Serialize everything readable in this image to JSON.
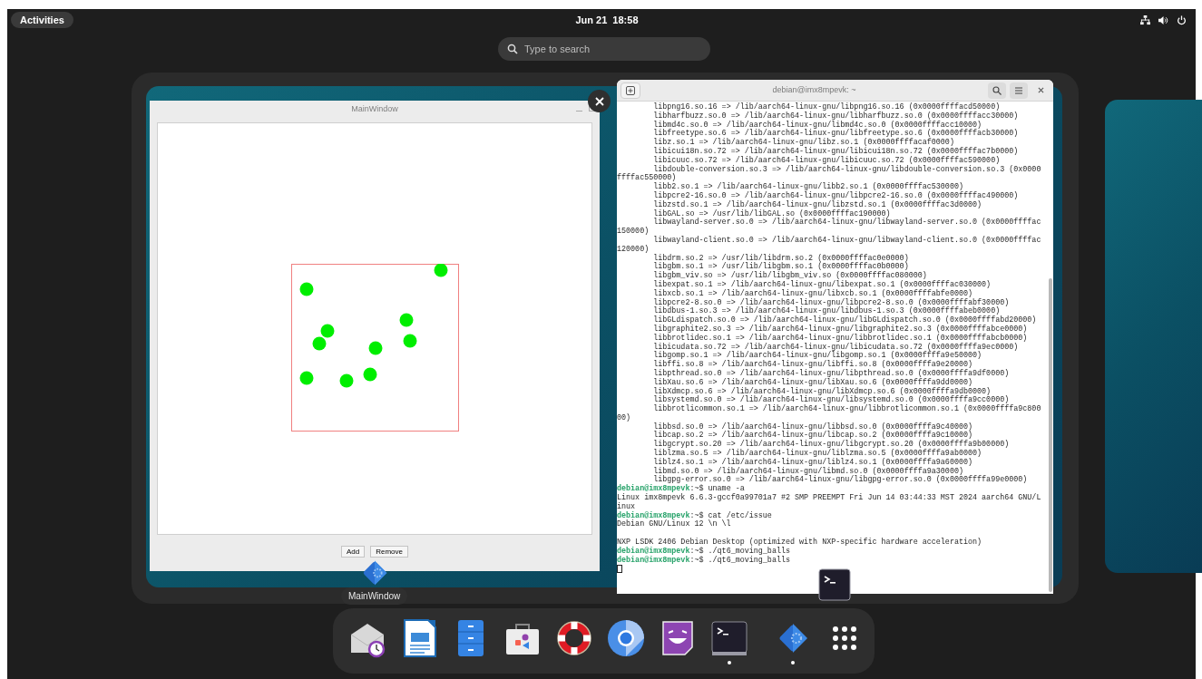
{
  "top_bar": {
    "activities": "Activities",
    "clock": "Jun 21  18:58"
  },
  "search": {
    "placeholder": "Type to search"
  },
  "qt_window": {
    "title": "MainWindow",
    "caption": "MainWindow",
    "buttons": [
      "Add",
      "Remove"
    ]
  },
  "terminal": {
    "title": "debian@imx8mpevk: ~",
    "lines": [
      {
        "kind": "output",
        "text": "\tlibpng16.so.16 => /lib/aarch64-linux-gnu/libpng16.so.16 (0x0000ffffacd50000)"
      },
      {
        "kind": "output",
        "text": "\tlibharfbuzz.so.0 => /lib/aarch64-linux-gnu/libharfbuzz.so.0 (0x0000ffffacc30000)"
      },
      {
        "kind": "output",
        "text": "\tlibmd4c.so.0 => /lib/aarch64-linux-gnu/libmd4c.so.0 (0x0000ffffacc10000)"
      },
      {
        "kind": "output",
        "text": "\tlibfreetype.so.6 => /lib/aarch64-linux-gnu/libfreetype.so.6 (0x0000ffffacb30000)"
      },
      {
        "kind": "output",
        "text": "\tlibz.so.1 => /lib/aarch64-linux-gnu/libz.so.1 (0x0000ffffacaf0000)"
      },
      {
        "kind": "output",
        "text": "\tlibicui18n.so.72 => /lib/aarch64-linux-gnu/libicui18n.so.72 (0x0000ffffac7b0000)"
      },
      {
        "kind": "output",
        "text": "\tlibicuuc.so.72 => /lib/aarch64-linux-gnu/libicuuc.so.72 (0x0000ffffac590000)"
      },
      {
        "kind": "output",
        "text": "\tlibdouble-conversion.so.3 => /lib/aarch64-linux-gnu/libdouble-conversion.so.3 (0x0000"
      },
      {
        "kind": "output",
        "text": "ffffac550000)"
      },
      {
        "kind": "output",
        "text": "\tlibb2.so.1 => /lib/aarch64-linux-gnu/libb2.so.1 (0x0000ffffac530000)"
      },
      {
        "kind": "output",
        "text": "\tlibpcre2-16.so.0 => /lib/aarch64-linux-gnu/libpcre2-16.so.0 (0x0000ffffac490000)"
      },
      {
        "kind": "output",
        "text": "\tlibzstd.so.1 => /lib/aarch64-linux-gnu/libzstd.so.1 (0x0000ffffac3d0000)"
      },
      {
        "kind": "output",
        "text": "\tlibGAL.so => /usr/lib/libGAL.so (0x0000ffffac190000)"
      },
      {
        "kind": "output",
        "text": "\tlibwayland-server.so.0 => /lib/aarch64-linux-gnu/libwayland-server.so.0 (0x0000ffffac"
      },
      {
        "kind": "output",
        "text": "150000)"
      },
      {
        "kind": "output",
        "text": "\tlibwayland-client.so.0 => /lib/aarch64-linux-gnu/libwayland-client.so.0 (0x0000ffffac"
      },
      {
        "kind": "output",
        "text": "120000)"
      },
      {
        "kind": "output",
        "text": "\tlibdrm.so.2 => /usr/lib/libdrm.so.2 (0x0000ffffac0e0000)"
      },
      {
        "kind": "output",
        "text": "\tlibgbm.so.1 => /usr/lib/libgbm.so.1 (0x0000ffffac0b0000)"
      },
      {
        "kind": "output",
        "text": "\tlibgbm_viv.so => /usr/lib/libgbm_viv.so (0x0000ffffac080000)"
      },
      {
        "kind": "output",
        "text": "\tlibexpat.so.1 => /lib/aarch64-linux-gnu/libexpat.so.1 (0x0000ffffac030000)"
      },
      {
        "kind": "output",
        "text": "\tlibxcb.so.1 => /lib/aarch64-linux-gnu/libxcb.so.1 (0x0000ffffabfe0000)"
      },
      {
        "kind": "output",
        "text": "\tlibpcre2-8.so.0 => /lib/aarch64-linux-gnu/libpcre2-8.so.0 (0x0000ffffabf30000)"
      },
      {
        "kind": "output",
        "text": "\tlibdbus-1.so.3 => /lib/aarch64-linux-gnu/libdbus-1.so.3 (0x0000ffffabeb0000)"
      },
      {
        "kind": "output",
        "text": "\tlibGLdispatch.so.0 => /lib/aarch64-linux-gnu/libGLdispatch.so.0 (0x0000ffffabd20000)"
      },
      {
        "kind": "output",
        "text": "\tlibgraphite2.so.3 => /lib/aarch64-linux-gnu/libgraphite2.so.3 (0x0000ffffabce0000)"
      },
      {
        "kind": "output",
        "text": "\tlibbrotlidec.so.1 => /lib/aarch64-linux-gnu/libbrotlidec.so.1 (0x0000ffffabcb0000)"
      },
      {
        "kind": "output",
        "text": "\tlibicudata.so.72 => /lib/aarch64-linux-gnu/libicudata.so.72 (0x0000ffffa9ec0000)"
      },
      {
        "kind": "output",
        "text": "\tlibgomp.so.1 => /lib/aarch64-linux-gnu/libgomp.so.1 (0x0000ffffa9e50000)"
      },
      {
        "kind": "output",
        "text": "\tlibffi.so.8 => /lib/aarch64-linux-gnu/libffi.so.8 (0x0000ffffa9e20000)"
      },
      {
        "kind": "output",
        "text": "\tlibpthread.so.0 => /lib/aarch64-linux-gnu/libpthread.so.0 (0x0000ffffa9df0000)"
      },
      {
        "kind": "output",
        "text": "\tlibXau.so.6 => /lib/aarch64-linux-gnu/libXau.so.6 (0x0000ffffa9dd0000)"
      },
      {
        "kind": "output",
        "text": "\tlibXdmcp.so.6 => /lib/aarch64-linux-gnu/libXdmcp.so.6 (0x0000ffffa9db0000)"
      },
      {
        "kind": "output",
        "text": "\tlibsystemd.so.0 => /lib/aarch64-linux-gnu/libsystemd.so.0 (0x0000ffffa9cc0000)"
      },
      {
        "kind": "output",
        "text": "\tlibbrotlicommon.so.1 => /lib/aarch64-linux-gnu/libbrotlicommon.so.1 (0x0000ffffa9c800"
      },
      {
        "kind": "output",
        "text": "00)"
      },
      {
        "kind": "output",
        "text": "\tlibbsd.so.0 => /lib/aarch64-linux-gnu/libbsd.so.0 (0x0000ffffa9c40000)"
      },
      {
        "kind": "output",
        "text": "\tlibcap.so.2 => /lib/aarch64-linux-gnu/libcap.so.2 (0x0000ffffa9c10000)"
      },
      {
        "kind": "output",
        "text": "\tlibgcrypt.so.20 => /lib/aarch64-linux-gnu/libgcrypt.so.20 (0x0000ffffa9b00000)"
      },
      {
        "kind": "output",
        "text": "\tliblzma.so.5 => /lib/aarch64-linux-gnu/liblzma.so.5 (0x0000ffffa9ab0000)"
      },
      {
        "kind": "output",
        "text": "\tliblz4.so.1 => /lib/aarch64-linux-gnu/liblz4.so.1 (0x0000ffffa9a60000)"
      },
      {
        "kind": "output",
        "text": "\tlibmd.so.0 => /lib/aarch64-linux-gnu/libmd.so.0 (0x0000ffffa9a30000)"
      },
      {
        "kind": "output",
        "text": "\tlibgpg-error.so.0 => /lib/aarch64-linux-gnu/libgpg-error.so.0 (0x0000ffffa99e0000)"
      },
      {
        "kind": "command",
        "prompt": "debian@imx8mpevk",
        "text": ":~$ uname -a"
      },
      {
        "kind": "output",
        "text": "Linux imx8mpevk 6.6.3-gccf0a99701a7 #2 SMP PREEMPT Fri Jun 14 03:44:33 MST 2024 aarch64 GNU/L"
      },
      {
        "kind": "output",
        "text": "inux"
      },
      {
        "kind": "command",
        "prompt": "debian@imx8mpevk",
        "text": ":~$ cat /etc/issue"
      },
      {
        "kind": "output",
        "text": "Debian GNU/Linux 12 \\n \\l"
      },
      {
        "kind": "blank"
      },
      {
        "kind": "output",
        "text": "NXP LSDK 2406 Debian Desktop (optimized with NXP-specific hardware acceleration)"
      },
      {
        "kind": "command",
        "prompt": "debian@imx8mpevk",
        "text": ":~$ ./qt6_moving_balls"
      },
      {
        "kind": "command",
        "prompt": "debian@imx8mpevk",
        "text": ":~$ ./qt6_moving_balls"
      },
      {
        "kind": "cursor"
      }
    ]
  },
  "dock": {
    "items": [
      {
        "kind": "calendar_mail",
        "running": false
      },
      {
        "kind": "writer",
        "running": false
      },
      {
        "kind": "files",
        "running": false
      },
      {
        "kind": "software",
        "running": false
      },
      {
        "kind": "help",
        "running": false
      },
      {
        "kind": "browser",
        "running": false
      },
      {
        "kind": "games",
        "running": false
      },
      {
        "kind": "terminal",
        "running": true
      },
      {
        "kind": "separator"
      },
      {
        "kind": "qt",
        "running": true
      },
      {
        "kind": "app_grid"
      }
    ]
  }
}
